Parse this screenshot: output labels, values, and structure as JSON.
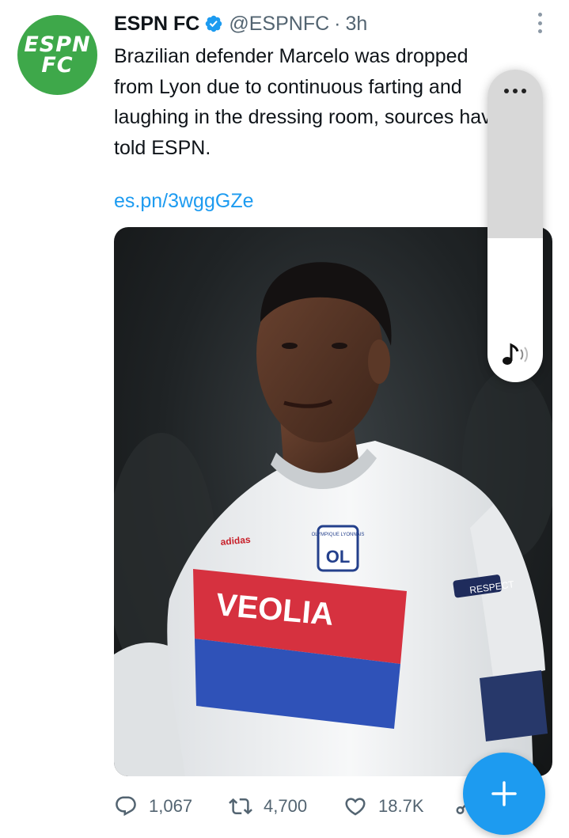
{
  "tweet": {
    "avatar_line1": "ESPN",
    "avatar_line2": "FC",
    "display_name": "ESPN FC",
    "verified_icon": "verified-badge-icon",
    "handle": "@ESPNFC",
    "separator": "·",
    "time": "3h",
    "text": "Brazilian defender Marcelo was dropped\nfrom Lyon due to continuous farting and\nlaughing in the dressing room, sources have\ntold ESPN.",
    "link": "es.pn/3wggGZe",
    "image": {
      "shirt_sponsor": "VEOLIA",
      "kit_brand": "adidas",
      "crest_text": "OLYMPIQUE LYONNAIS",
      "crest_initials": "OL",
      "sleeve_patch": "RESPECT"
    }
  },
  "actions": {
    "replies": "1,067",
    "retweets": "4,700",
    "likes": "18.7K"
  },
  "volume_panel": {
    "level": 0.46,
    "menu_icon": "more-icon",
    "sound_icon": "music-note-icon"
  },
  "fab": {
    "icon": "plus-icon"
  },
  "colors": {
    "accent": "#1d9bf0",
    "secondary_text": "#536471",
    "avatar_green": "#3ea84a",
    "stripe_red": "#d6313f",
    "stripe_blue": "#2f52b8"
  }
}
